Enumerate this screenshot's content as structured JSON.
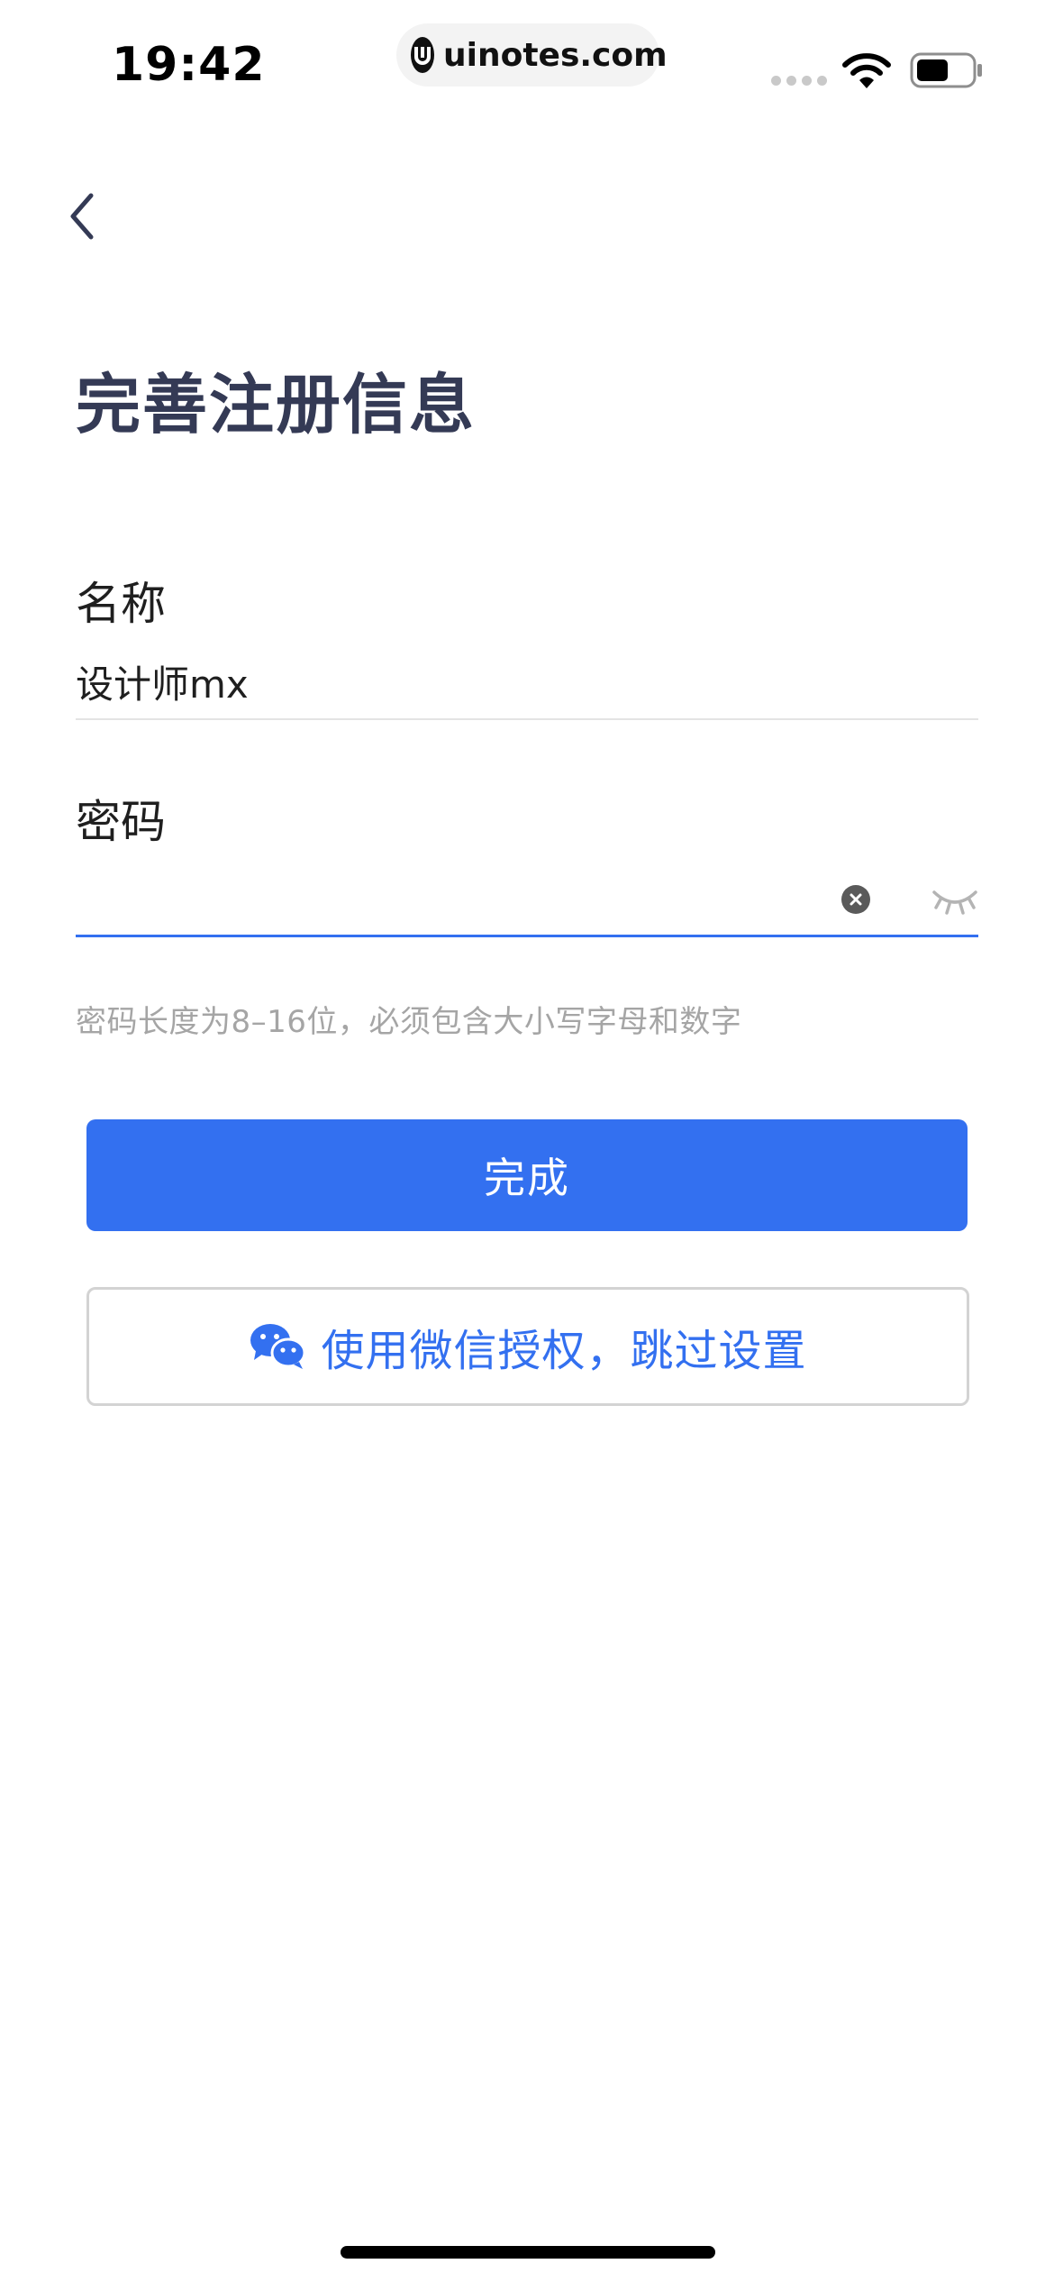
{
  "status_bar": {
    "time": "19:42",
    "url": "uinotes.com",
    "icons": [
      "signal-icon",
      "wifi-icon",
      "battery-icon"
    ]
  },
  "nav": {
    "back_icon": "chevron-left-icon"
  },
  "page": {
    "title": "完善注册信息"
  },
  "form": {
    "name": {
      "label": "名称",
      "value": "设计师mx"
    },
    "password": {
      "label": "密码",
      "value": "",
      "clear_icon": "clear-icon",
      "visibility_icon": "eye-closed-icon",
      "hint": "密码长度为8–16位，必须包含大小写字母和数字"
    }
  },
  "actions": {
    "done_label": "完成",
    "wechat_label": "使用微信授权，跳过设置",
    "wechat_icon": "wechat-icon"
  },
  "colors": {
    "accent": "#3370f0",
    "title": "#343a55",
    "hint": "#a5a5a5",
    "divider": "#e4e4e4"
  }
}
